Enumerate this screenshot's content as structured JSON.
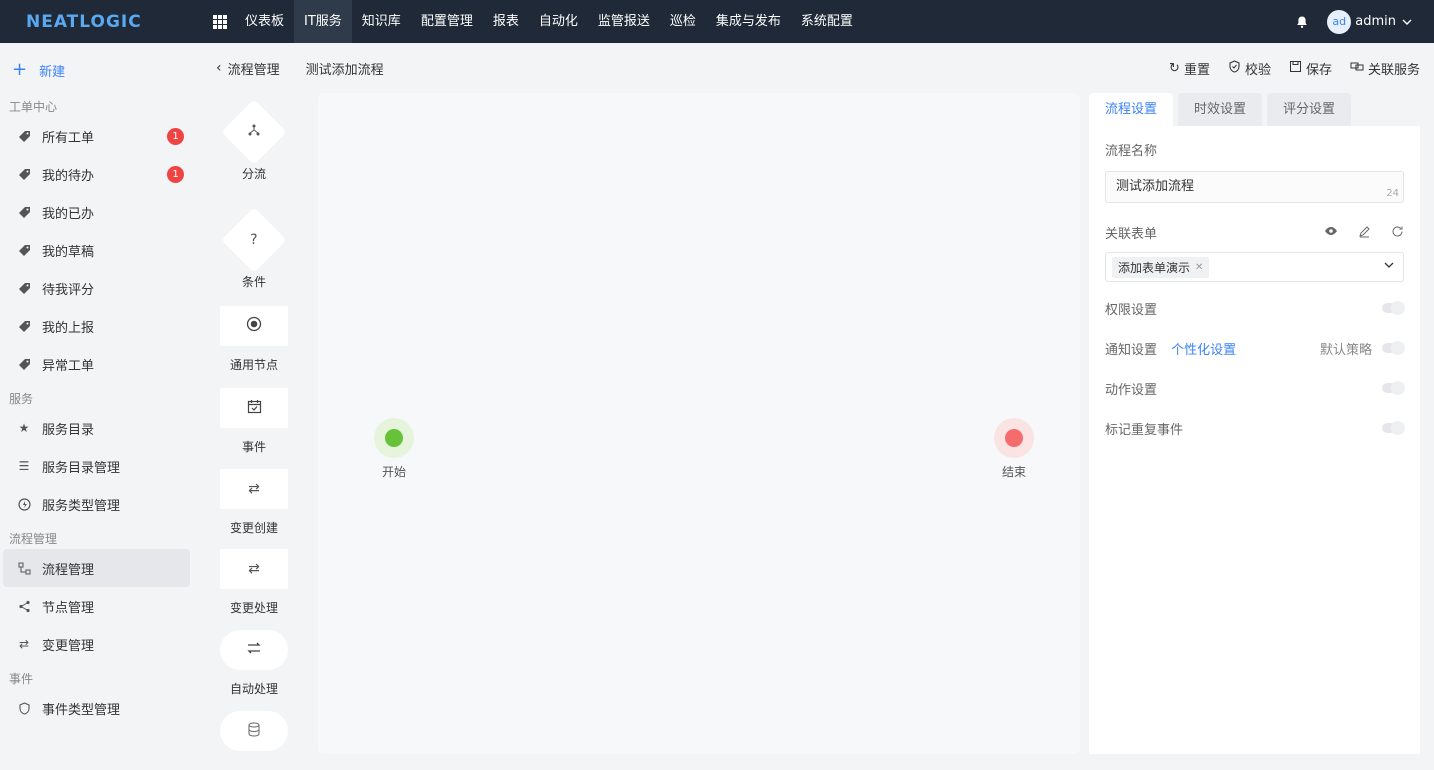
{
  "app": {
    "logo": "NEATLOGIC"
  },
  "nav": {
    "items": [
      "仪表板",
      "IT服务",
      "知识库",
      "配置管理",
      "报表",
      "自动化",
      "监管报送",
      "巡检",
      "集成与发布",
      "系统配置"
    ],
    "active_index": 1
  },
  "user": {
    "avatar": "ad",
    "name": "admin"
  },
  "sidebar": {
    "new_label": "新建",
    "groups": [
      {
        "title": "工单中心",
        "items": [
          {
            "label": "所有工单",
            "badge": "1"
          },
          {
            "label": "我的待办",
            "badge": "1"
          },
          {
            "label": "我的已办"
          },
          {
            "label": "我的草稿"
          },
          {
            "label": "待我评分"
          },
          {
            "label": "我的上报"
          },
          {
            "label": "异常工单"
          }
        ]
      },
      {
        "title": "服务",
        "items": [
          {
            "label": "服务目录"
          },
          {
            "label": "服务目录管理"
          },
          {
            "label": "服务类型管理"
          }
        ]
      },
      {
        "title": "流程管理",
        "items": [
          {
            "label": "流程管理",
            "active": true
          },
          {
            "label": "节点管理"
          },
          {
            "label": "变更管理"
          }
        ]
      },
      {
        "title": "事件",
        "items": [
          {
            "label": "事件类型管理"
          }
        ]
      }
    ]
  },
  "breadcrumb": {
    "parent": "流程管理",
    "current": "测试添加流程"
  },
  "actions": {
    "reset": "重置",
    "validate": "校验",
    "save": "保存",
    "related_service": "关联服务"
  },
  "palette": {
    "nodes": [
      {
        "label": "分流",
        "icon": "branch-icon"
      },
      {
        "label": "条件",
        "icon": "question-icon"
      },
      {
        "label": "通用节点",
        "icon": "radio-icon"
      },
      {
        "label": "事件",
        "icon": "calendar-icon"
      },
      {
        "label": "变更创建",
        "icon": "exchange-icon"
      },
      {
        "label": "变更处理",
        "icon": "exchange-icon"
      },
      {
        "label": "自动处理",
        "icon": "auto-icon"
      },
      {
        "label": "",
        "icon": "database-icon"
      }
    ]
  },
  "canvas": {
    "start_label": "开始",
    "end_label": "结束",
    "start_color": "#67c23a",
    "end_color": "#f56c6c"
  },
  "panel": {
    "tabs": [
      "流程设置",
      "时效设置",
      "评分设置"
    ],
    "name_label": "流程名称",
    "name_value": "测试添加流程",
    "name_count": "24",
    "form_label": "关联表单",
    "form_tag": "添加表单演示",
    "permission_label": "权限设置",
    "notify_label": "通知设置",
    "notify_link": "个性化设置",
    "notify_default": "默认策略",
    "action_label": "动作设置",
    "duplicate_label": "标记重复事件"
  },
  "colors": {
    "topbar": "#1f2937",
    "accent": "#3b82f6",
    "badge": "#ef4444"
  }
}
